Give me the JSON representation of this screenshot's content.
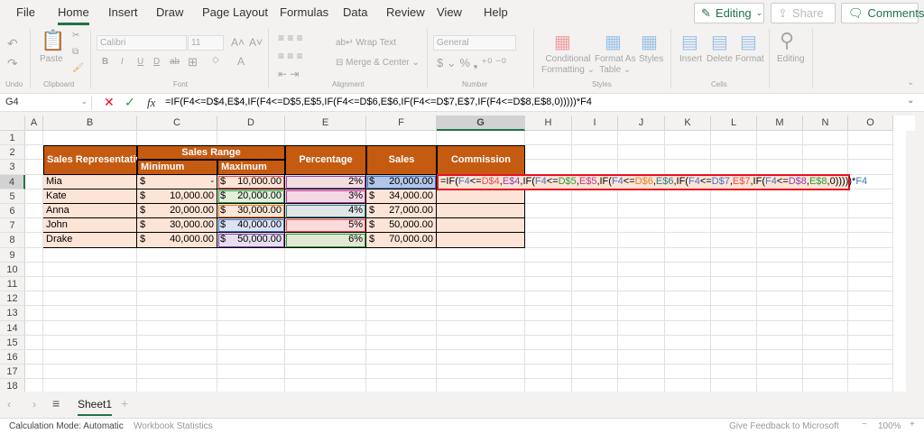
{
  "menu": {
    "tabs": [
      "File",
      "Home",
      "Insert",
      "Draw",
      "Page Layout",
      "Formulas",
      "Data",
      "Review",
      "View",
      "Help"
    ],
    "active": "Home",
    "editing": "Editing",
    "share": "Share",
    "comments": "Comments"
  },
  "ribbon": {
    "groups": {
      "undo": "Undo",
      "clipboard": "Clipboard",
      "font": "Font",
      "alignment": "Alignment",
      "number": "Number",
      "styles": "Styles",
      "cells": "Cells"
    },
    "paste": "Paste",
    "font_name": "Calibri",
    "font_size": "11",
    "wrap_text": "Wrap Text",
    "merge_center": "Merge & Center",
    "number_format": "General",
    "conditional_formatting": [
      "Conditional",
      "Formatting"
    ],
    "format_as_table": [
      "Format As",
      "Table"
    ],
    "styles": "Styles",
    "insert": "Insert",
    "delete": "Delete",
    "format": "Format",
    "editing": "Editing"
  },
  "formula_bar": {
    "name_box": "G4",
    "formula": "=IF(F4<=D$4,E$4,IF(F4<=D$5,E$5,IF(F4<=D$6,E$6,IF(F4<=D$7,E$7,IF(F4<=D$8,E$8,0)))))*F4"
  },
  "columns": [
    "A",
    "B",
    "C",
    "D",
    "E",
    "F",
    "G",
    "H",
    "I",
    "J",
    "K",
    "L",
    "M",
    "N",
    "O"
  ],
  "rows": [
    "1",
    "2",
    "3",
    "4",
    "5",
    "6",
    "7",
    "8",
    "9",
    "10",
    "11",
    "12",
    "13",
    "14",
    "15",
    "16",
    "17",
    "18",
    "19",
    "20",
    "21"
  ],
  "table": {
    "headers": {
      "rep": "Sales Representative",
      "range": "Sales Range",
      "min": "Minimum",
      "max": "Maximum",
      "pct": "Percentage",
      "sales": "Sales",
      "commission": "Commission"
    },
    "rows": [
      {
        "name": "Mia",
        "min": "-",
        "max": "10,000.00",
        "pct": "2%",
        "sales": "20,000.00"
      },
      {
        "name": "Kate",
        "min": "10,000.00",
        "max": "20,000.00",
        "pct": "3%",
        "sales": "34,000.00"
      },
      {
        "name": "Anna",
        "min": "20,000.00",
        "max": "30,000.00",
        "pct": "4%",
        "sales": "27,000.00"
      },
      {
        "name": "John",
        "min": "30,000.00",
        "max": "40,000.00",
        "pct": "5%",
        "sales": "50,000.00"
      },
      {
        "name": "Drake",
        "min": "40,000.00",
        "max": "50,000.00",
        "pct": "6%",
        "sales": "70,000.00"
      }
    ],
    "currency": "$"
  },
  "edit_formula": [
    {
      "t": "=IF(",
      "c": "#000000"
    },
    {
      "t": "F4",
      "c": "#4472c4"
    },
    {
      "t": "<=",
      "c": "#000000"
    },
    {
      "t": "D$4",
      "c": "#e74c4c"
    },
    {
      "t": ",",
      "c": "#000000"
    },
    {
      "t": "E$4",
      "c": "#8e44ad"
    },
    {
      "t": ",IF(",
      "c": "#000000"
    },
    {
      "t": "F4",
      "c": "#4472c4"
    },
    {
      "t": "<=",
      "c": "#000000"
    },
    {
      "t": "D$5",
      "c": "#2e9e44"
    },
    {
      "t": ",",
      "c": "#000000"
    },
    {
      "t": "E$5",
      "c": "#c0398a"
    },
    {
      "t": ",IF(",
      "c": "#000000"
    },
    {
      "t": "F4",
      "c": "#4472c4"
    },
    {
      "t": "<=",
      "c": "#000000"
    },
    {
      "t": "D$6",
      "c": "#e67e22"
    },
    {
      "t": ",",
      "c": "#000000"
    },
    {
      "t": "E$6",
      "c": "#2e7d8c"
    },
    {
      "t": ",IF(",
      "c": "#000000"
    },
    {
      "t": "F4",
      "c": "#4472c4"
    },
    {
      "t": "<=",
      "c": "#000000"
    },
    {
      "t": "D$7",
      "c": "#4472c4"
    },
    {
      "t": ",",
      "c": "#000000"
    },
    {
      "t": "E$7",
      "c": "#e74c4c"
    },
    {
      "t": ",IF(",
      "c": "#000000"
    },
    {
      "t": "F4",
      "c": "#4472c4"
    },
    {
      "t": "<=",
      "c": "#000000"
    },
    {
      "t": "D$8",
      "c": "#8e44ad"
    },
    {
      "t": ",",
      "c": "#000000"
    },
    {
      "t": "E$8",
      "c": "#2e9e44"
    },
    {
      "t": ",0)))))*",
      "c": "#000000"
    },
    {
      "t": "F4",
      "c": "#4472c4"
    }
  ],
  "sheets": {
    "active": "Sheet1"
  },
  "status": {
    "calc_mode": "Calculation Mode: Automatic",
    "workbook_stats": "Workbook Statistics",
    "feedback": "Give Feedback to Microsoft",
    "zoom": "100%"
  },
  "colors": {
    "accent": "#217346",
    "header_fill": "#c55a11",
    "body_fill": "#fce4d6",
    "edit_border": "#e81123"
  }
}
